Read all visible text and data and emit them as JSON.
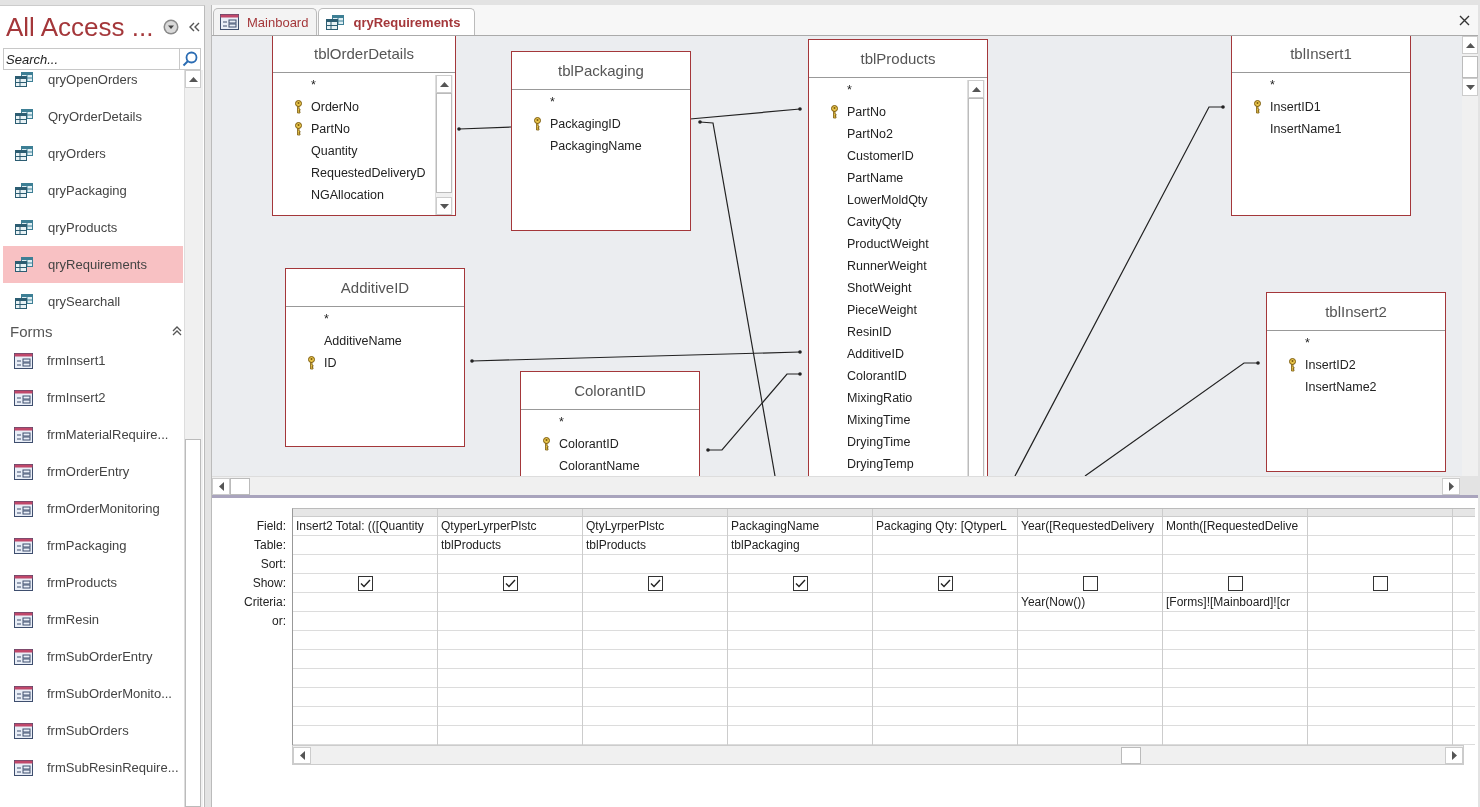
{
  "nav": {
    "title": "All Access ...",
    "search": {
      "placeholder": "Search..."
    },
    "sections": [
      {
        "items": [
          {
            "label": "qryOpenOrders",
            "kind": "query",
            "selected": false
          },
          {
            "label": "QryOrderDetails",
            "kind": "query",
            "selected": false
          },
          {
            "label": "qryOrders",
            "kind": "query",
            "selected": false
          },
          {
            "label": "qryPackaging",
            "kind": "query",
            "selected": false
          },
          {
            "label": "qryProducts",
            "kind": "query",
            "selected": false
          },
          {
            "label": "qryRequirements",
            "kind": "query",
            "selected": true
          },
          {
            "label": "qrySearchall",
            "kind": "query",
            "selected": false
          }
        ]
      },
      {
        "header": "Forms",
        "expanded": true,
        "items": [
          {
            "label": "frmInsert1",
            "kind": "form",
            "selected": false
          },
          {
            "label": "frmInsert2",
            "kind": "form",
            "selected": false
          },
          {
            "label": "frmMaterialRequire...",
            "kind": "form",
            "selected": false
          },
          {
            "label": "frmOrderEntry",
            "kind": "form",
            "selected": false
          },
          {
            "label": "frmOrderMonitoring",
            "kind": "form",
            "selected": false
          },
          {
            "label": "frmPackaging",
            "kind": "form",
            "selected": false
          },
          {
            "label": "frmProducts",
            "kind": "form",
            "selected": false
          },
          {
            "label": "frmResin",
            "kind": "form",
            "selected": false
          },
          {
            "label": "frmSubOrderEntry",
            "kind": "form",
            "selected": false
          },
          {
            "label": "frmSubOrderMonito...",
            "kind": "form",
            "selected": false
          },
          {
            "label": "frmSubOrders",
            "kind": "form",
            "selected": false
          },
          {
            "label": "frmSubResinRequire...",
            "kind": "form",
            "selected": false
          }
        ]
      }
    ]
  },
  "tabs": [
    {
      "label": "Mainboard",
      "kind": "form",
      "selected": false
    },
    {
      "label": "qryRequirements",
      "kind": "query",
      "selected": true
    }
  ],
  "diagram": {
    "tables": [
      {
        "title": "tblOrderDetails",
        "fields": [
          {
            "name": "*",
            "key": false
          },
          {
            "name": "OrderNo",
            "key": true
          },
          {
            "name": "PartNo",
            "key": true
          },
          {
            "name": "Quantity",
            "key": false
          },
          {
            "name": "RequestedDeliveryD",
            "key": false
          },
          {
            "name": "NGAllocation",
            "key": false
          }
        ]
      },
      {
        "title": "tblPackaging",
        "fields": [
          {
            "name": "*",
            "key": false
          },
          {
            "name": "PackagingID",
            "key": true
          },
          {
            "name": "PackagingName",
            "key": false
          }
        ]
      },
      {
        "title": "tblProducts",
        "fields": [
          {
            "name": "*",
            "key": false
          },
          {
            "name": "PartNo",
            "key": true
          },
          {
            "name": "PartNo2",
            "key": false
          },
          {
            "name": "CustomerID",
            "key": false
          },
          {
            "name": "PartName",
            "key": false
          },
          {
            "name": "LowerMoldQty",
            "key": false
          },
          {
            "name": "CavityQty",
            "key": false
          },
          {
            "name": "ProductWeight",
            "key": false
          },
          {
            "name": "RunnerWeight",
            "key": false
          },
          {
            "name": "ShotWeight",
            "key": false
          },
          {
            "name": "PieceWeight",
            "key": false
          },
          {
            "name": "ResinID",
            "key": false
          },
          {
            "name": "AdditiveID",
            "key": false
          },
          {
            "name": "ColorantID",
            "key": false
          },
          {
            "name": "MixingRatio",
            "key": false
          },
          {
            "name": "MixingTime",
            "key": false
          },
          {
            "name": "DryingTime",
            "key": false
          },
          {
            "name": "DryingTemp",
            "key": false
          }
        ]
      },
      {
        "title": "tblInsert1",
        "fields": [
          {
            "name": "*",
            "key": false
          },
          {
            "name": "InsertID1",
            "key": true
          },
          {
            "name": "InsertName1",
            "key": false
          }
        ]
      },
      {
        "title": "AdditiveID",
        "fields": [
          {
            "name": "*",
            "key": false
          },
          {
            "name": "AdditiveName",
            "key": false
          },
          {
            "name": "ID",
            "key": true
          }
        ]
      },
      {
        "title": "ColorantID",
        "fields": [
          {
            "name": "*",
            "key": false
          },
          {
            "name": "ColorantID",
            "key": true
          },
          {
            "name": "ColorantName",
            "key": false
          }
        ]
      },
      {
        "title": "tblInsert2",
        "fields": [
          {
            "name": "*",
            "key": false
          },
          {
            "name": "InsertID2",
            "key": true
          },
          {
            "name": "InsertName2",
            "key": false
          }
        ]
      }
    ]
  },
  "grid": {
    "row_labels": [
      "Field:",
      "Table:",
      "Sort:",
      "Show:",
      "Criteria:",
      "or:"
    ],
    "columns": [
      {
        "field": "Insert2 Total: (([Quantity",
        "show": true
      },
      {
        "field": "QtyperLyrperPlstc",
        "table": "tblProducts",
        "show": true
      },
      {
        "field": "QtyLyrperPlstc",
        "table": "tblProducts",
        "show": true
      },
      {
        "field": "PackagingName",
        "table": "tblPackaging",
        "show": true
      },
      {
        "field": "Packaging Qty: [QtyperL",
        "show": true
      },
      {
        "field": "Year([RequestedDelivery",
        "show": false,
        "criteria": "Year(Now())"
      },
      {
        "field": "Month([RequestedDelive",
        "show": false,
        "criteria": "[Forms]![Mainboard]![cr"
      },
      {
        "show": false
      }
    ]
  }
}
